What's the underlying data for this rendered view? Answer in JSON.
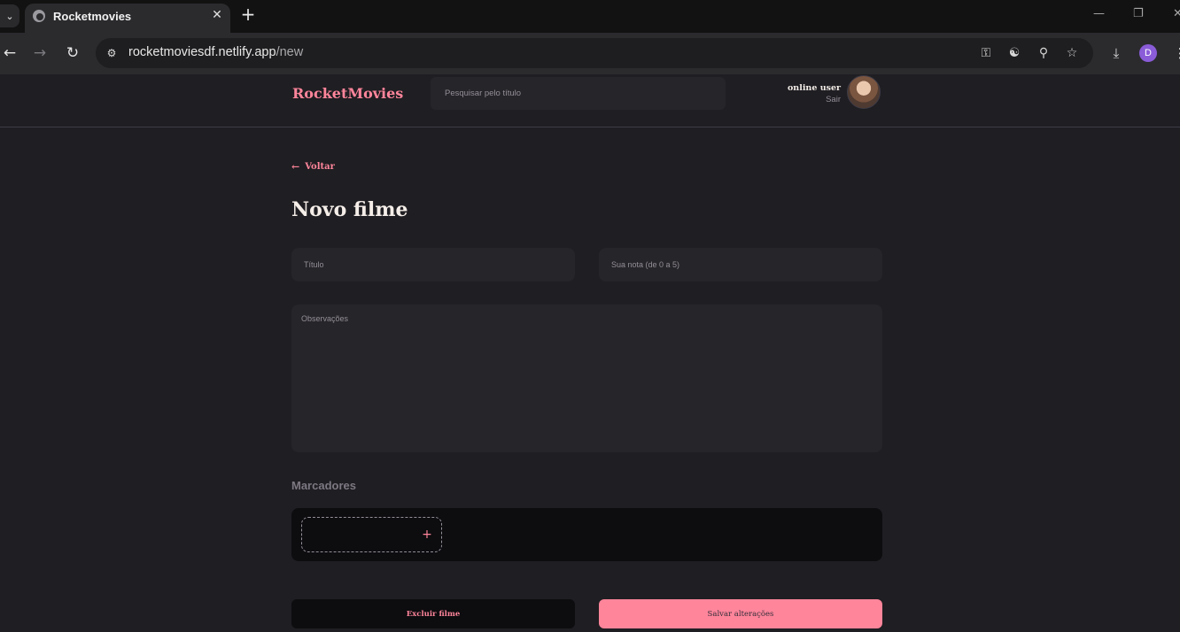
{
  "browser": {
    "tab_title": "Rocketmovies",
    "url_host": "rocketmoviesdf.netlify.app",
    "url_path": "/new",
    "profile_initial": "D",
    "icons": [
      "tab-list-icon",
      "globe-icon",
      "close-icon",
      "plus-icon",
      "minimize-icon",
      "restore-icon",
      "back-arrow-icon",
      "forward-arrow-icon",
      "reload-icon",
      "site-info-icon",
      "key-icon",
      "translate-icon",
      "zoom-icon",
      "star-icon",
      "download-icon",
      "menu-dots-icon"
    ]
  },
  "header": {
    "brand": "RocketMovies",
    "search_placeholder": "Pesquisar pelo título",
    "user_name": "online user",
    "signout": "Sair"
  },
  "page": {
    "back_label": "Voltar",
    "title": "Novo filme",
    "title_placeholder": "Título",
    "rating_placeholder": "Sua nota (de 0 a 5)",
    "notes_placeholder": "Observações",
    "tags_title": "Marcadores",
    "add_tag_symbol": "+",
    "delete_label": "Excluir filme",
    "save_label": "Salvar alterações"
  },
  "colors": {
    "accent": "#ff859b",
    "background": "#1f1e22",
    "input_bg": "#262529",
    "tags_bg": "#0d0c0f",
    "text_primary": "#f4ede8",
    "text_muted": "#948f99"
  }
}
